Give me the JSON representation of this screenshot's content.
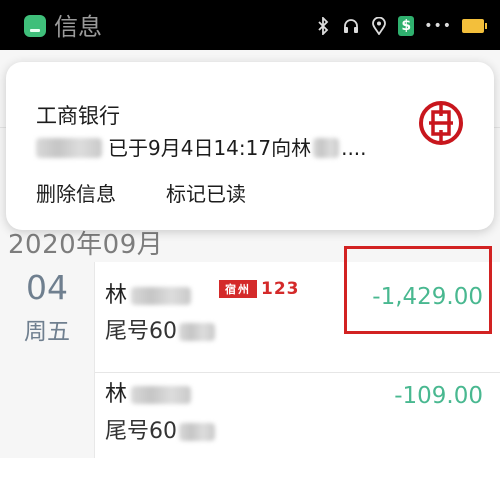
{
  "status_bar": {
    "title": "信息",
    "icons": [
      "bluetooth-icon",
      "headset-icon",
      "location-icon",
      "app-dollar-icon",
      "more-dots-icon",
      "battery-icon"
    ],
    "dollar_glyph": "$",
    "dots": "•••",
    "colors": {
      "background": "#000000",
      "app_icon": "#3fbf7a",
      "battery": "#f3bf3b"
    }
  },
  "notification": {
    "app_name": "工商银行",
    "body_text_1": "已于9月4日14:17向林",
    "body_text_2": "....",
    "actions": [
      {
        "label": "删除信息"
      },
      {
        "label": "标记已读"
      }
    ],
    "logo_icon": "icbc-logo-icon",
    "logo_color": "#c8161d"
  },
  "statement": {
    "month_header": "2020年09月",
    "date": {
      "day": "04",
      "weekday": "周五"
    },
    "transactions": [
      {
        "name": "林",
        "sub": "尾号60",
        "amount": "-1,429.00"
      },
      {
        "name": "林",
        "sub": "尾号60",
        "amount": "-109.00"
      }
    ],
    "amount_color": "#49b890"
  },
  "watermark": {
    "text": "123"
  },
  "highlight": {
    "color": "#d22222"
  }
}
